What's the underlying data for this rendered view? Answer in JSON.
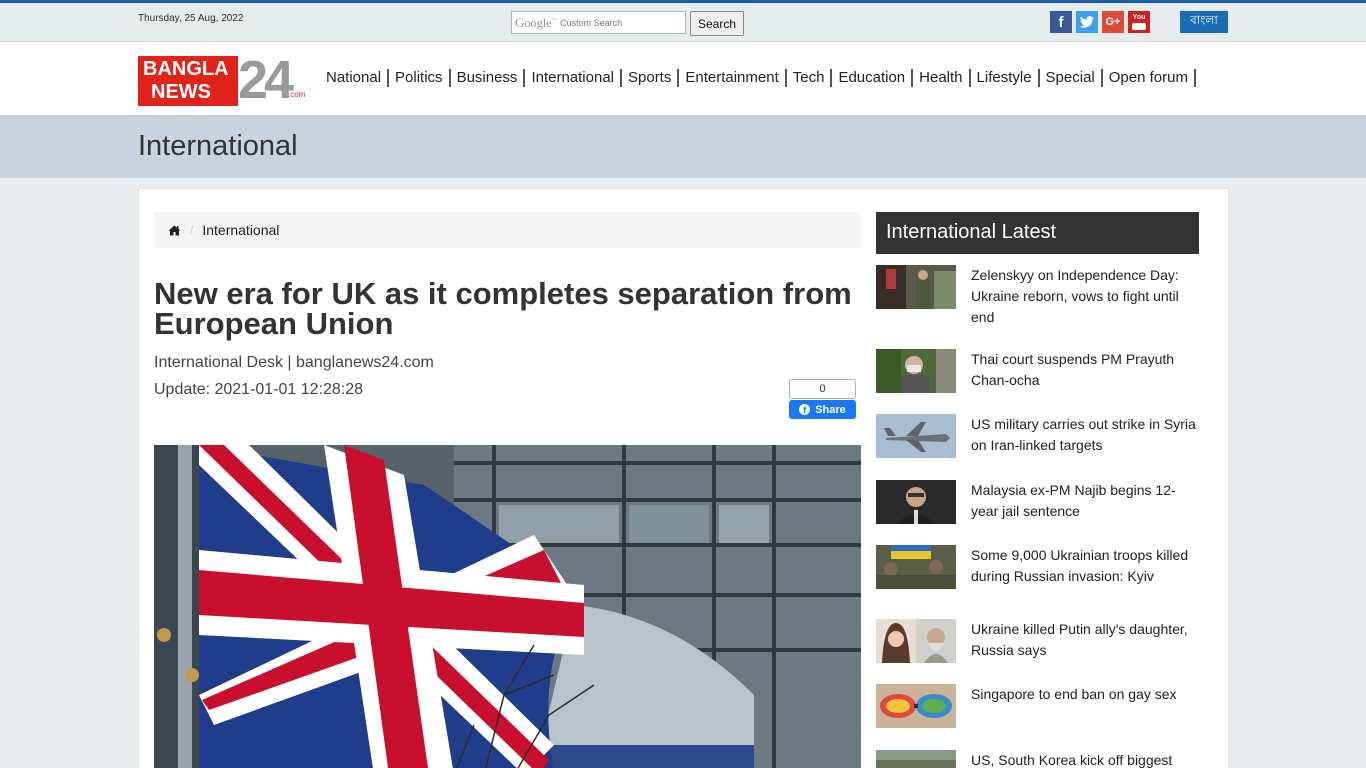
{
  "topbar": {
    "date": "Thursday, 25 Aug, 2022",
    "search_brand": "Google",
    "search_placeholder": "Custom Search",
    "search_button": "Search",
    "language_button": "বাংলা",
    "social": [
      {
        "icon": "facebook-icon",
        "glyph": "f"
      },
      {
        "icon": "twitter-icon",
        "glyph": "t"
      },
      {
        "icon": "google-plus-icon",
        "glyph": "G+"
      },
      {
        "icon": "youtube-icon",
        "glyph": "You"
      }
    ]
  },
  "logo": {
    "line1": "BANGLA",
    "line2": "NEWS",
    "number": "24",
    "suffix": ".com"
  },
  "nav": [
    "National",
    "Politics",
    "Business",
    "International",
    "Sports",
    "Entertainment",
    "Tech",
    "Education",
    "Health",
    "Lifestyle",
    "Special",
    "Open forum"
  ],
  "section_title": "International",
  "breadcrumb": {
    "home_icon": "home-icon",
    "current": "International"
  },
  "article": {
    "headline": "New era for UK as it completes separation from European Union",
    "byline": "International Desk | banglanews24.com",
    "update": "Update: 2021-01-01 12:28:28",
    "share_count": "0",
    "share_label": "Share"
  },
  "sidebar": {
    "title": "International Latest",
    "items": [
      {
        "title": "Zelenskyy on Independence Day: Ukraine reborn, vows to fight until end"
      },
      {
        "title": "Thai court suspends PM Prayuth Chan-ocha"
      },
      {
        "title": "US military carries out strike in Syria on Iran-linked targets"
      },
      {
        "title": "Malaysia ex-PM Najib begins 12-year jail sentence"
      },
      {
        "title": "Some 9,000 Ukrainian troops killed during Russian invasion: Kyiv"
      },
      {
        "title": "Ukraine killed Putin ally's daughter, Russia says"
      },
      {
        "title": "Singapore to end ban on gay sex"
      },
      {
        "title": "US, South Korea kick off biggest"
      }
    ]
  },
  "colors": {
    "accent_blue": "#1a5fa8",
    "logo_red": "#e2231a",
    "band_bg": "#c7d3dd",
    "sidebar_head_bg": "#333333"
  }
}
